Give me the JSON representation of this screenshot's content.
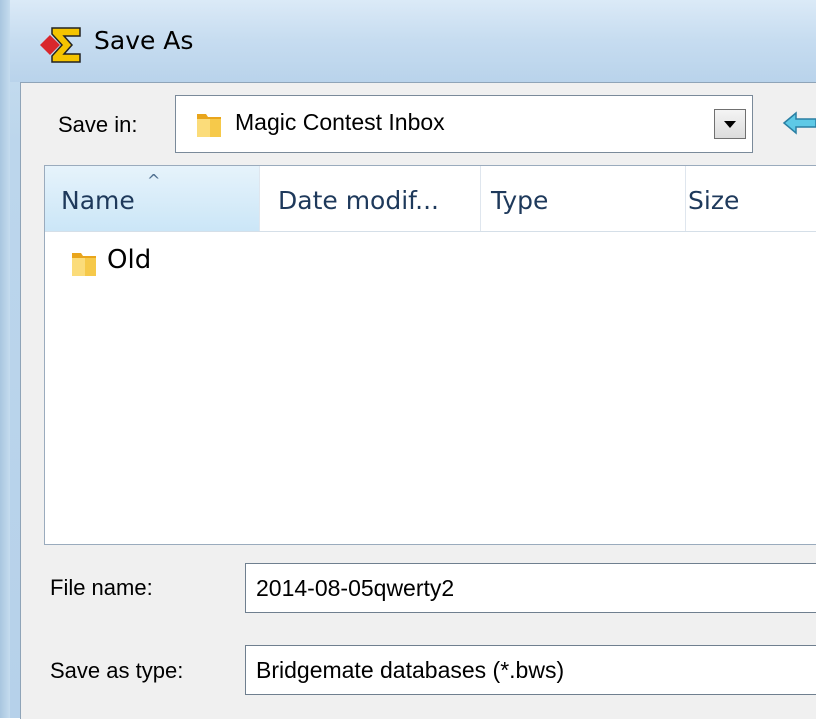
{
  "window": {
    "title": "Save As",
    "app_icon": "sigma-app-icon"
  },
  "toolbar": {
    "save_in_label": "Save in:",
    "save_in_value": "Magic Contest Inbox",
    "save_in_icon": "folder-icon",
    "dropdown_icon": "chevron-down-icon",
    "back_icon": "back-arrow-icon"
  },
  "file_list": {
    "columns": [
      {
        "label": "Name",
        "sorted": true
      },
      {
        "label": "Date modif..."
      },
      {
        "label": "Type"
      },
      {
        "label": "Size"
      }
    ],
    "items": [
      {
        "name": "Old",
        "icon": "folder-icon"
      }
    ]
  },
  "form": {
    "file_name_label": "File name:",
    "file_name_value": "2014-08-05qwerty2",
    "save_as_type_label": "Save as type:",
    "save_as_type_value": "Bridgemate databases (*.bws)"
  },
  "colors": {
    "title_bar": "#c6dcf0",
    "client_bg": "#f0f0f0",
    "header_text": "#1e395b",
    "sorted_column": "#cbe6f7"
  }
}
